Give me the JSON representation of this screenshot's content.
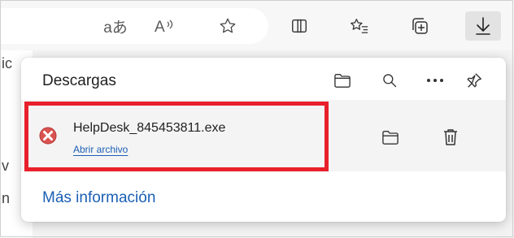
{
  "toolbar": {
    "read_aloud_text": "aあ",
    "immersive_text": "À⁾",
    "icons": [
      "translate-icon",
      "read-aloud-icon",
      "favorite-star-icon",
      "split-screen-icon",
      "favorites-list-icon",
      "collections-icon",
      "downloads-icon"
    ]
  },
  "page_edge": {
    "chars": [
      "ic",
      "v",
      "n"
    ]
  },
  "downloads_panel": {
    "title": "Descargas",
    "icons": [
      "open-folder-icon",
      "search-icon",
      "more-options-icon",
      "pin-icon"
    ],
    "item": {
      "file_name": "HelpDesk_845453811.exe",
      "action_link": "Abrir archivo",
      "status_icon": "error-icon",
      "buttons": [
        "show-in-folder-icon",
        "delete-icon"
      ]
    },
    "more_info": "Más información"
  },
  "colors": {
    "highlight": "#e8202b",
    "link": "#1a5fb4",
    "error": "#d9534f"
  }
}
